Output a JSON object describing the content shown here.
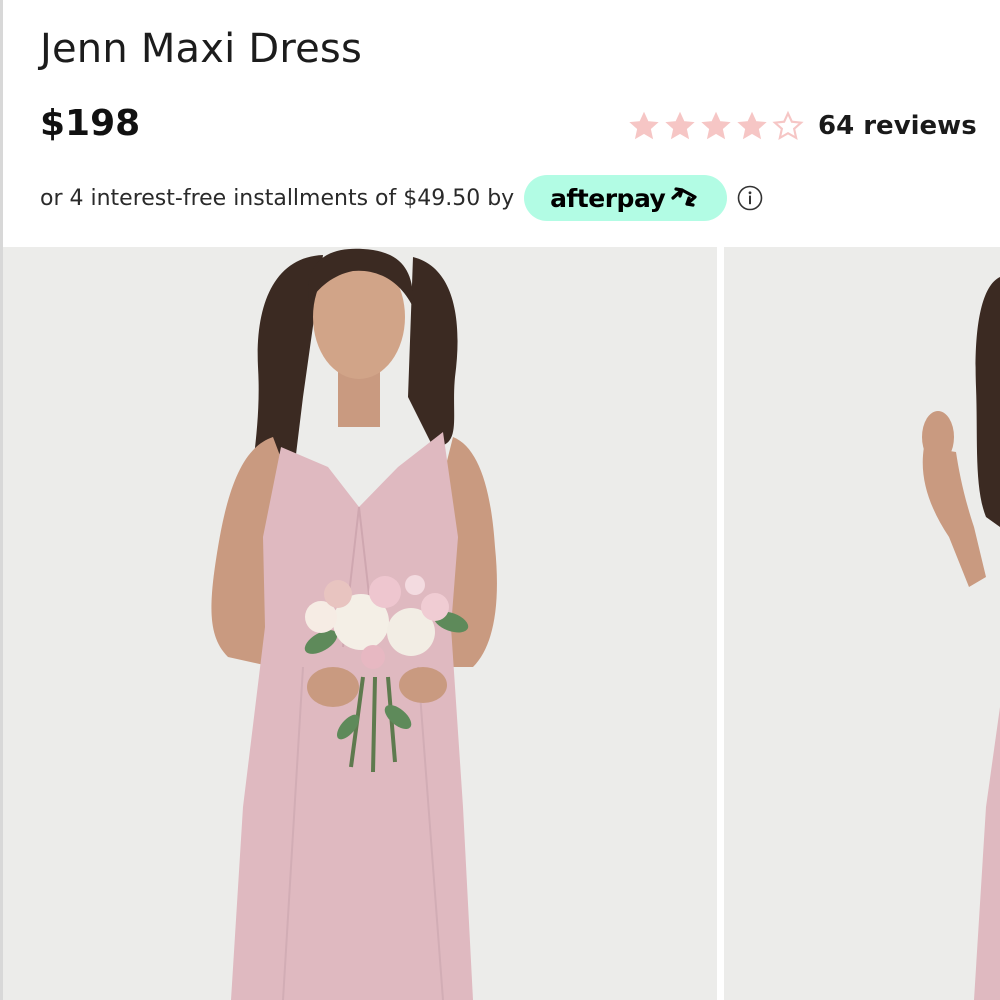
{
  "product": {
    "title": "Jenn Maxi Dress",
    "price": "$198"
  },
  "rating": {
    "value": 4,
    "max": 5,
    "reviews_label": "64 reviews",
    "star_color": "#f6c6c5",
    "icon": "star-icon"
  },
  "installments": {
    "text": "or 4 interest-free installments of $49.50 by",
    "provider_label": "afterpay",
    "provider_color": "#b2fce4",
    "info_icon": "info-icon"
  },
  "gallery": {
    "images": [
      {
        "alt": "Model wearing pink dress holding bouquet"
      },
      {
        "alt": "Model wearing pink dress"
      }
    ],
    "background_color": "#ececea",
    "dress_color": "#dfb9c0"
  }
}
